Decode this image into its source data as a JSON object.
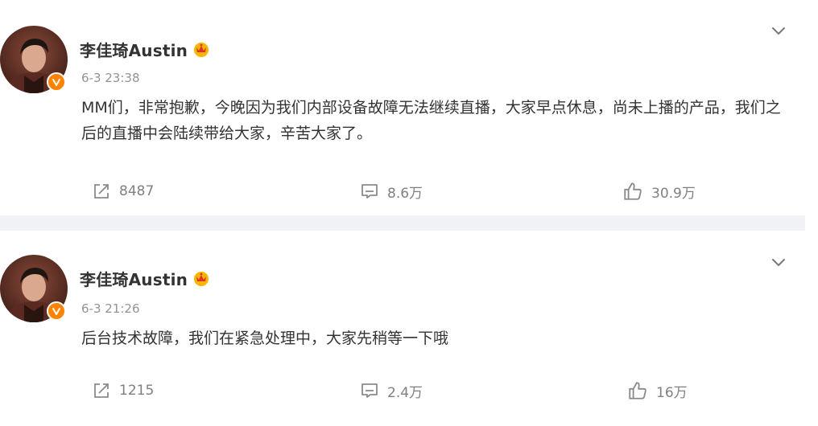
{
  "theme": {
    "text": "#333333",
    "meta": "#939393",
    "action": "#808080",
    "divider": "#f1f2f5",
    "verified": "#ff8200"
  },
  "posts": [
    {
      "user": {
        "name": "李佳琦Austin",
        "badge_icon": "crown-icon",
        "verified_icon": "verified-v-icon"
      },
      "time": "6-3 23:38",
      "content": "MM们，非常抱歉，今晚因为我们内部设备故障无法继续直播，大家早点休息，尚未上播的产品，我们之后的直播中会陆续带给大家，辛苦大家了。",
      "repost_count": "8487",
      "comment_count": "8.6万",
      "like_count": "30.9万"
    },
    {
      "user": {
        "name": "李佳琦Austin",
        "badge_icon": "crown-icon",
        "verified_icon": "verified-v-icon"
      },
      "time": "6-3 21:26",
      "content": "后台技术故障，我们在紧急处理中，大家先稍等一下哦",
      "repost_count": "1215",
      "comment_count": "2.4万",
      "like_count": "16万"
    }
  ]
}
